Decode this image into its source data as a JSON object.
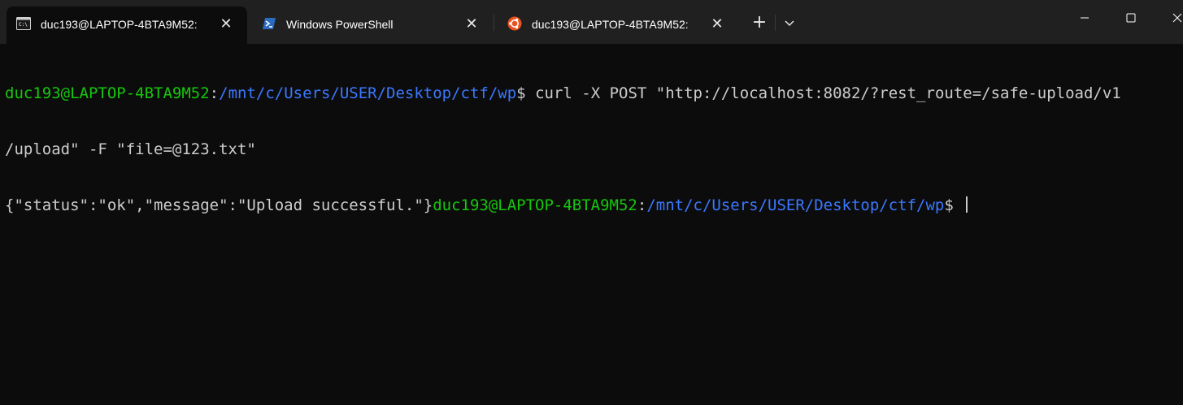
{
  "tabs": [
    {
      "label": "duc193@LAPTOP-4BTA9M52: ",
      "icon": "terminal-icon",
      "active": true
    },
    {
      "label": "Windows PowerShell",
      "icon": "powershell-icon",
      "active": false
    },
    {
      "label": "duc193@LAPTOP-4BTA9M52: ~",
      "icon": "ubuntu-icon",
      "active": false
    }
  ],
  "tab_close_glyph": "✕",
  "new_tab_glyph": "+",
  "terminal": {
    "line1": {
      "user_host": "duc193@LAPTOP-4BTA9M52",
      "colon": ":",
      "path": "/mnt/c/Users/USER/Desktop/ctf/wp",
      "prompt": "$ ",
      "command": "curl -X POST \"http://localhost:8082/?rest_route=/safe-upload/v1"
    },
    "line2": {
      "text": "/upload\" -F \"file=@123.txt\""
    },
    "line3": {
      "output": "{\"status\":\"ok\",\"message\":\"Upload successful.\"}",
      "user_host": "duc193@LAPTOP-4BTA9M52",
      "colon": ":",
      "path": "/mnt/c/Users/USER/Desktop/ctf/wp",
      "prompt": "$ "
    }
  },
  "colors": {
    "background": "#0c0c0c",
    "titlebar": "#202020",
    "user_host": "#16c60c",
    "path": "#3b78ff",
    "text": "#cccccc"
  }
}
